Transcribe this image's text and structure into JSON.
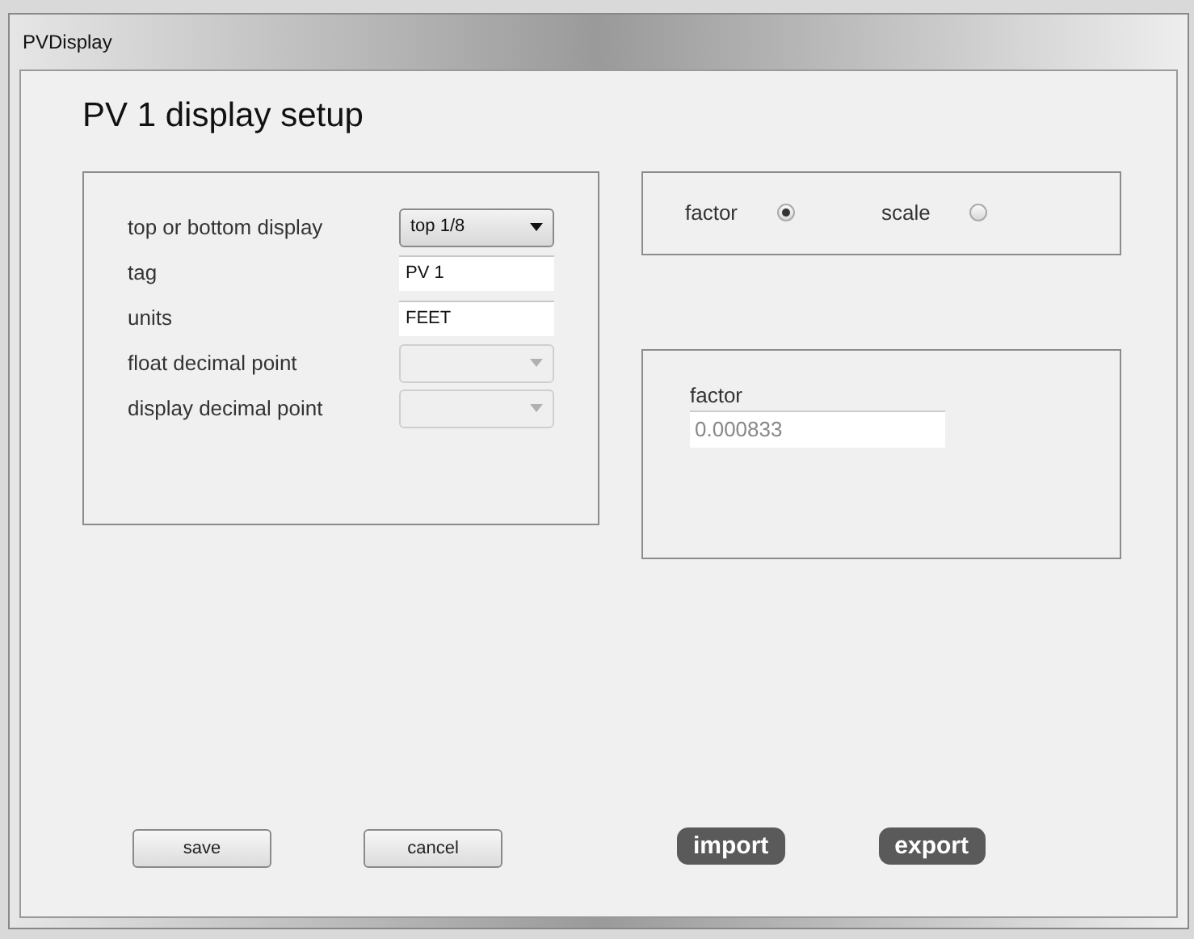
{
  "window": {
    "title": "PVDisplay"
  },
  "heading": "PV 1 display setup",
  "fields": [
    {
      "label": "top or bottom display",
      "kind": "dropdown",
      "value": "top 1/8",
      "disabled": false
    },
    {
      "label": "tag",
      "kind": "text",
      "value": "PV 1",
      "disabled": false
    },
    {
      "label": "units",
      "kind": "text",
      "value": "FEET",
      "disabled": false
    },
    {
      "label": "float decimal point",
      "kind": "dropdown",
      "disabled": true
    },
    {
      "label": "display decimal point",
      "kind": "dropdown",
      "disabled": true
    }
  ],
  "mode_options": [
    {
      "label": "factor",
      "selected": true
    },
    {
      "label": "scale",
      "selected": false
    }
  ],
  "factor_panel": {
    "label": "factor",
    "value": "0.000833"
  },
  "buttons": [
    {
      "label": "save",
      "kind": "plain"
    },
    {
      "label": "cancel",
      "kind": "plain"
    },
    {
      "label": "import",
      "kind": "dark"
    },
    {
      "label": "export",
      "kind": "dark"
    }
  ]
}
